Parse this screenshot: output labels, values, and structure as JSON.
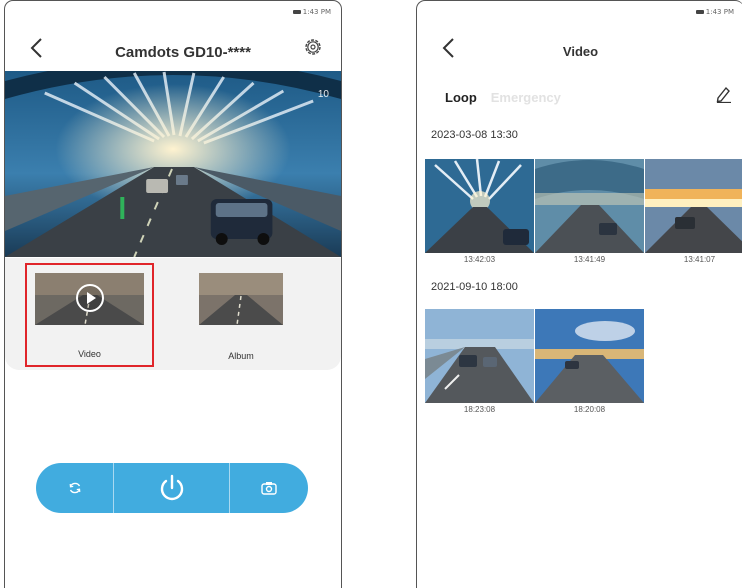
{
  "left_screen": {
    "status_time": "1:43 PM",
    "title": "Camdots GD10-****",
    "preview_timestamp": "10",
    "tiles": [
      {
        "label": "Video"
      },
      {
        "label": "Album"
      }
    ],
    "controls": {
      "left_icon": "refresh-icon",
      "center_icon": "power-icon",
      "right_icon": "camera-icon",
      "accent_color": "#41acdf"
    }
  },
  "right_screen": {
    "status_time": "1:43 PM",
    "title": "Video",
    "tabs": [
      {
        "label": "Loop",
        "active": true
      },
      {
        "label": "Emergency",
        "active": false
      }
    ],
    "groups": [
      {
        "date": "2023-03-08 13:30",
        "clips": [
          "13:42:03",
          "13:41:49",
          "13:41:07"
        ]
      },
      {
        "date": "2021-09-10 18:00",
        "clips": [
          "18:23:08",
          "18:20:08"
        ]
      }
    ]
  },
  "highlight_color": "#e0252a"
}
